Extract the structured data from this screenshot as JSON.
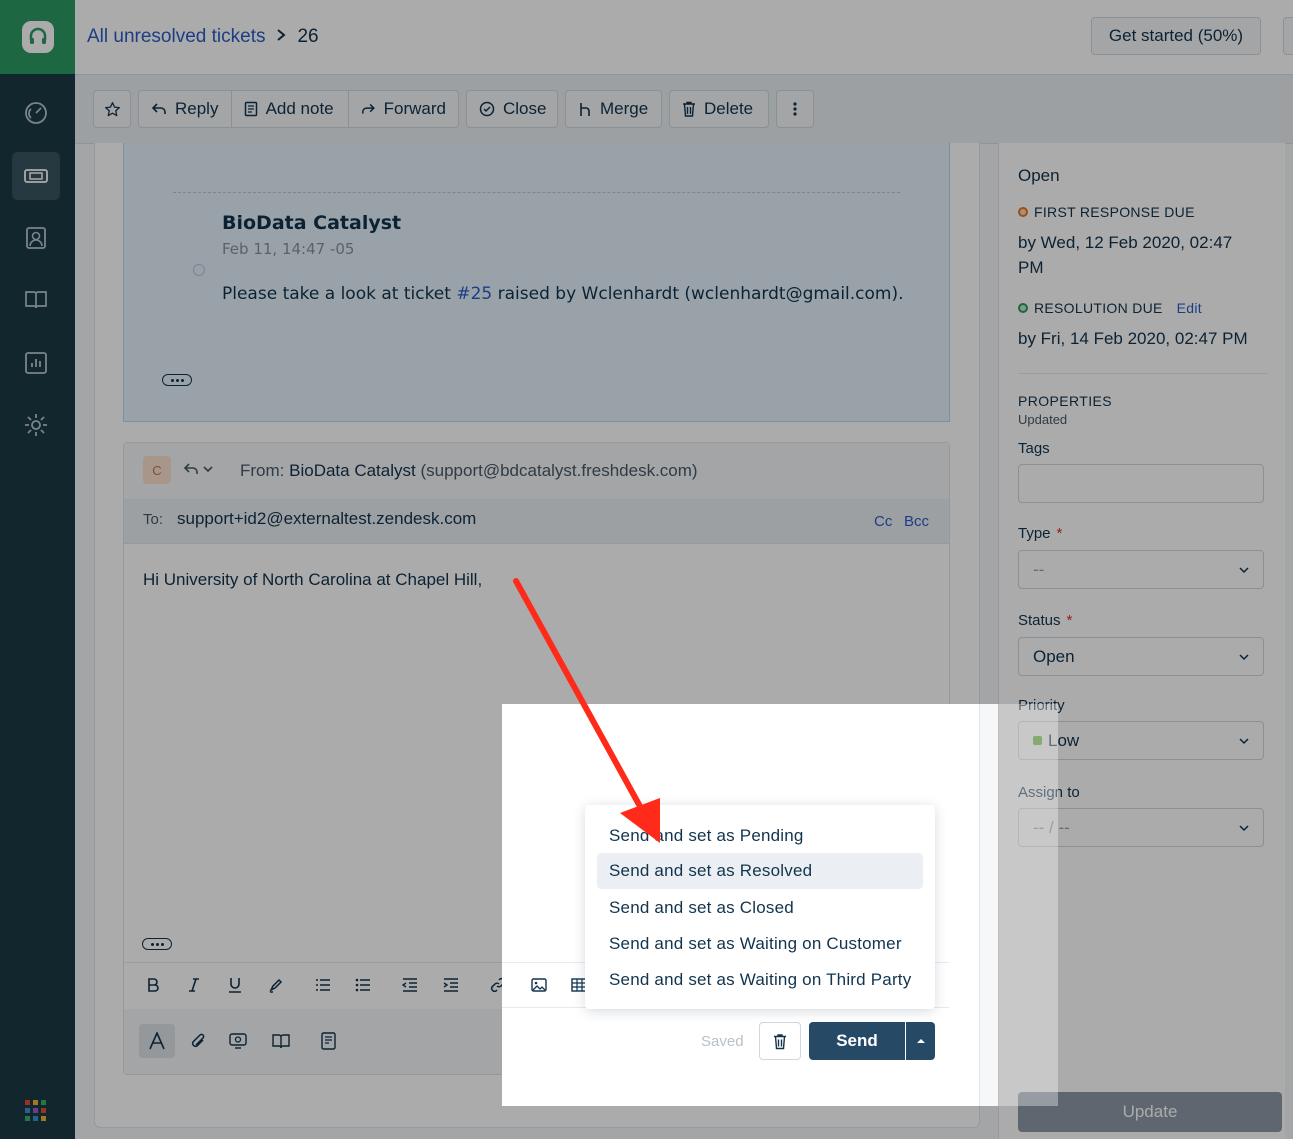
{
  "header": {
    "breadcrumb_link": "All unresolved tickets",
    "breadcrumb_sep": ">",
    "ticket_number": "26",
    "get_started": "Get started (50%)"
  },
  "toolbar": {
    "reply": "Reply",
    "add_note": "Add note",
    "forward": "Forward",
    "close": "Close",
    "merge": "Merge",
    "delete": "Delete"
  },
  "note": {
    "author": "BioData Catalyst",
    "time": "Feb 11, 14:47 -05",
    "body_before": "Please take a look at ticket ",
    "ticket_link": "#25",
    "body_after": " raised by Wclenhardt (wclenhardt@gmail.com)."
  },
  "reply": {
    "avatar_letter": "C",
    "from_label": "From:",
    "from_name": "BioData Catalyst",
    "from_email": "(support@bdcatalyst.freshdesk.com)",
    "to_label": "To:",
    "to_value": "support+id2@externaltest.zendesk.com",
    "cc": "Cc",
    "bcc": "Bcc",
    "body": "Hi University of North Carolina at Chapel Hill,",
    "saved": "Saved",
    "send": "Send"
  },
  "send_menu": {
    "items": [
      "Send and set as Pending",
      "Send and set as Resolved",
      "Send and set as Closed",
      "Send and set as Waiting on Customer",
      "Send and set as Waiting on Third Party"
    ],
    "highlighted": "Send and set as Resolved"
  },
  "right_panel": {
    "status": "Open",
    "first_response_label": "FIRST RESPONSE DUE",
    "first_response_line1": "by Wed, 12 Feb 2020, 02:47",
    "first_response_line2": "PM",
    "resolution_label": "RESOLUTION DUE",
    "edit": "Edit",
    "resolution_value": "by Fri, 14 Feb 2020, 02:47 PM",
    "properties_title": "PROPERTIES",
    "properties_sub": "Updated",
    "tags_label": "Tags",
    "type_label": "Type",
    "type_value": "--",
    "status_label": "Status",
    "status_value": "Open",
    "priority_label": "Priority",
    "priority_value": "Low",
    "assign_label": "Assign to",
    "assign_value": "-- / --",
    "required_mark": "*",
    "update": "Update"
  },
  "colors": {
    "sla_first_response": "#e8761c",
    "sla_resolution": "#2c9a63",
    "priority_low": "#66bc33",
    "annotation_arrow": "#ff2a1a"
  }
}
